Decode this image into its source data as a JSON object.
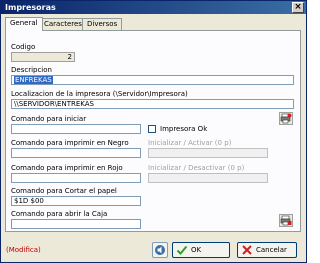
{
  "window": {
    "title": "Impresoras",
    "close_glyph": "×"
  },
  "tabs": [
    {
      "label": "General",
      "active": true
    },
    {
      "label": "Caracteres",
      "active": false
    },
    {
      "label": "Diversos",
      "active": false
    }
  ],
  "form": {
    "codigo": {
      "label": "Codigo",
      "value": "2"
    },
    "descripcion": {
      "label": "Descripcion",
      "value": "ENFREKAS"
    },
    "localizacion": {
      "label": "Localizacion de la impresora (\\Servidor\\Impresora)",
      "value": "\\\\SERVIDOR\\ENTREKAS"
    },
    "comando_iniciar": {
      "label": "Comando para iniciar",
      "value": ""
    },
    "impresora_ok": {
      "label": "Impresora Ok",
      "checked": false
    },
    "comando_negro": {
      "label": "Comando para imprimir en Negro",
      "value": ""
    },
    "inicializar_activar": {
      "label": "Inicializar / Activar (0 p)",
      "value": ""
    },
    "comando_rojo": {
      "label": "Comando para imprimir en Rojo",
      "value": ""
    },
    "inicializar_desactivar": {
      "label": "Inicializar / Desactivar (0 p)",
      "value": ""
    },
    "comando_cortar": {
      "label": "Comando para Cortar el papel",
      "value": "$1D $00"
    },
    "comando_caja": {
      "label": "Comando para abrir la Caja",
      "value": ""
    }
  },
  "statusbar": {
    "status": "(Modifica)"
  },
  "buttons": {
    "ok": "OK",
    "cancel": "Cancelar"
  },
  "icons": {
    "printer_settings": "printer-config-icon",
    "printer_test": "printer-test-icon",
    "sound": "speaker-icon",
    "ok": "checkmark-icon",
    "cancel": "x-icon"
  },
  "colors": {
    "titlebar": "#0a246a",
    "selection": "#316ac5",
    "status": "#c00000",
    "ok_icon": "#2f9e2f",
    "cancel_icon": "#d02020"
  }
}
